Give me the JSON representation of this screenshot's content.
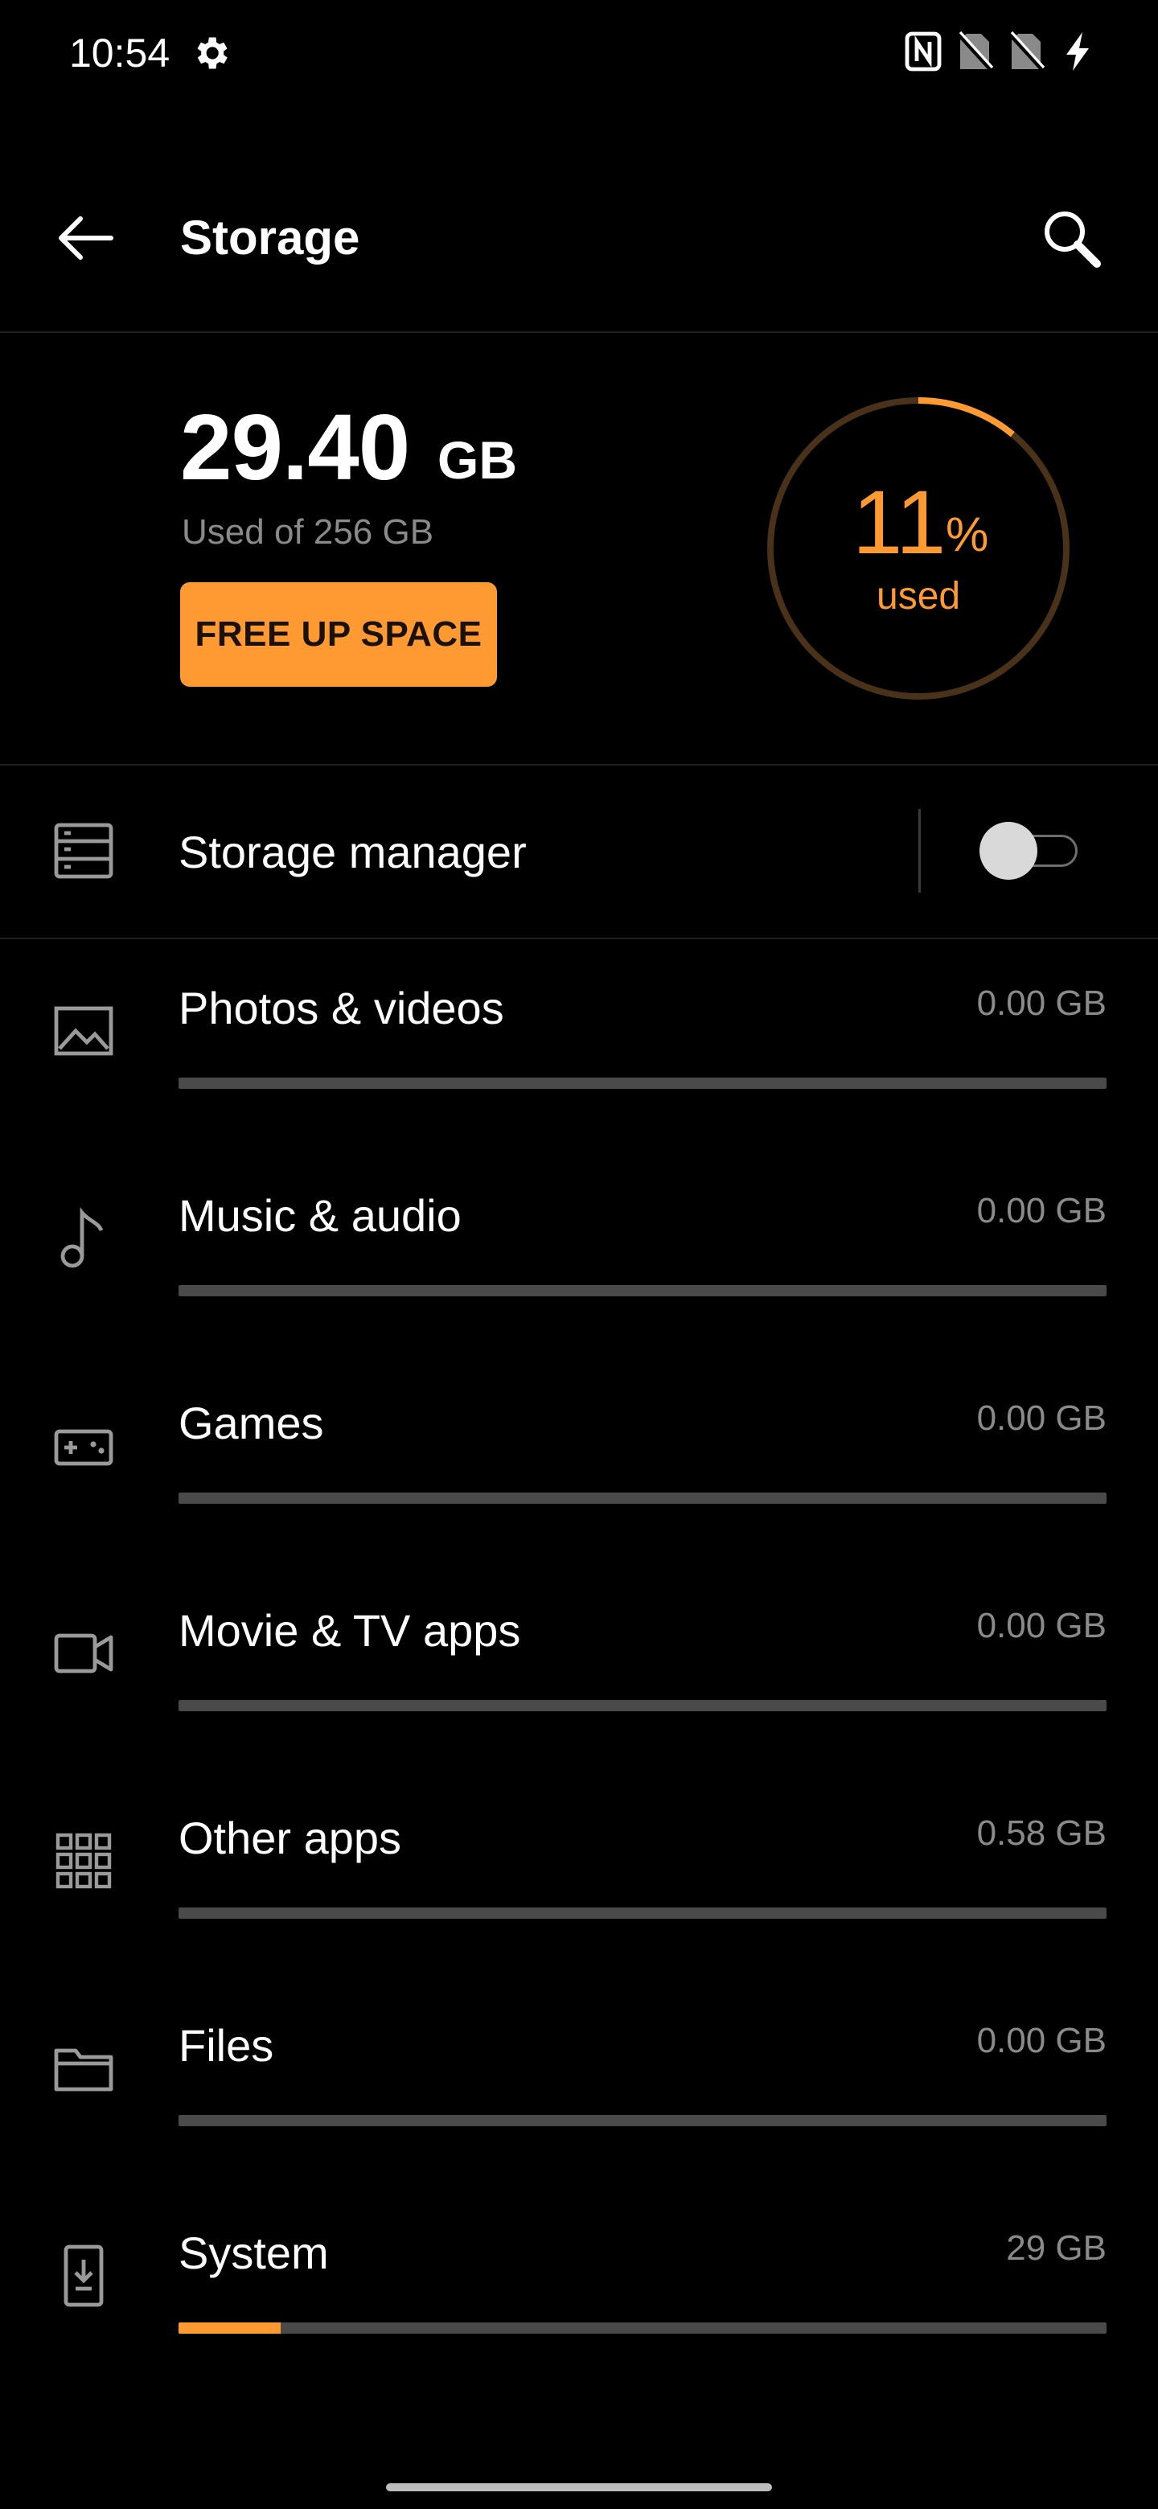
{
  "status_bar": {
    "time": "10:54",
    "icons": [
      "settings-gear",
      "nfc",
      "no-sim-1",
      "no-sim-2",
      "charging-bolt"
    ]
  },
  "app_bar": {
    "title": "Storage",
    "back_icon": "arrow-left",
    "search_icon": "search"
  },
  "summary": {
    "used_value": "29.40",
    "used_unit": "GB",
    "used_of": "Used of 256 GB",
    "free_up_label": "FREE UP SPACE",
    "percent": "11",
    "percent_symbol": "%",
    "percent_caption": "used",
    "used_fraction": 0.11
  },
  "storage_manager": {
    "label": "Storage manager",
    "enabled": false
  },
  "categories": [
    {
      "label": "Photos & videos",
      "size": "0.00 GB",
      "icon": "image",
      "fill_fraction": 0.0
    },
    {
      "label": "Music & audio",
      "size": "0.00 GB",
      "icon": "music-note",
      "fill_fraction": 0.0
    },
    {
      "label": "Games",
      "size": "0.00 GB",
      "icon": "gamepad",
      "fill_fraction": 0.0
    },
    {
      "label": "Movie & TV apps",
      "size": "0.00 GB",
      "icon": "video-camera",
      "fill_fraction": 0.0
    },
    {
      "label": "Other apps",
      "size": "0.58 GB",
      "icon": "apps-grid",
      "fill_fraction": 0.0
    },
    {
      "label": "Files",
      "size": "0.00 GB",
      "icon": "folder",
      "fill_fraction": 0.0
    },
    {
      "label": "System",
      "size": "29 GB",
      "icon": "system-download",
      "fill_fraction": 0.11
    }
  ],
  "colors": {
    "accent": "#ff9a32",
    "ring_track": "#4a3119",
    "background": "#000000",
    "secondary_text": "#8a8a8a",
    "bar_track": "#4a4a4a"
  }
}
